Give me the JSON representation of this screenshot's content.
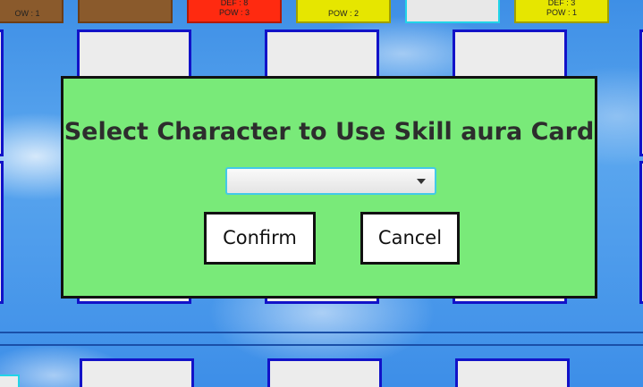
{
  "top_cards": [
    {
      "lines": [
        "OW : 1"
      ],
      "color": "#8a5a2c"
    },
    {
      "lines": [],
      "color": "#8a5a2c"
    },
    {
      "lines": [
        "DEF : 8",
        "POW : 3"
      ],
      "color": "#ff2a10"
    },
    {
      "lines": [
        "POW : 2"
      ],
      "color": "#e6e600"
    },
    {
      "lines": [],
      "color": "#e8e8e8"
    },
    {
      "lines": [
        "DEF : 3",
        "POW : 1"
      ],
      "color": "#e6e600"
    }
  ],
  "dialog": {
    "title": "Select Character to Use Skill aura Card",
    "dropdown_value": "",
    "dropdown_icon": "chevron-down-icon",
    "confirm_label": "Confirm",
    "cancel_label": "Cancel",
    "background": "#79ea79"
  },
  "colors": {
    "slot_border": "#1212c8",
    "slot_fill": "#ececec",
    "sky": "#4a9aea"
  }
}
